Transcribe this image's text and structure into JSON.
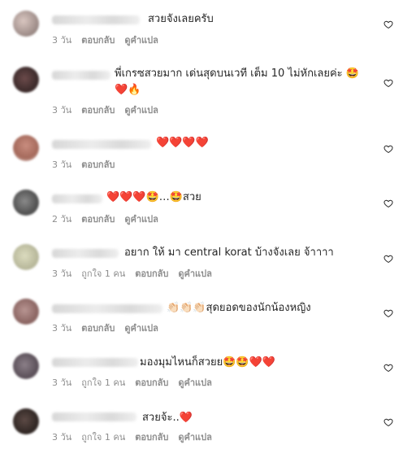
{
  "comments": [
    {
      "text": "สวยจังเลยครับ",
      "time": "3 วัน",
      "reply": "ตอบกลับ",
      "translate": "ดูคำแปล"
    },
    {
      "text": "พี่เกรซสวยมาก เด่นสุดบนเวที เต็ม 10 ไม่หักเลยค่ะ 🤩\n❤️🔥",
      "time": "3 วัน",
      "reply": "ตอบกลับ",
      "translate": "ดูคำแปล"
    },
    {
      "text": "❤️❤️❤️❤️",
      "time": "3 วัน",
      "reply": "ตอบกลับ"
    },
    {
      "text": "❤️❤️❤️🤩…🤩สวย",
      "time": "2 วัน",
      "reply": "ตอบกลับ",
      "translate": "ดูคำแปล"
    },
    {
      "text": "อยาก ให้ มา central korat บ้างจังเลย จ้าาาา",
      "time": "3 วัน",
      "likes": "ถูกใจ 1 คน",
      "reply": "ตอบกลับ",
      "translate": "ดูคำแปล"
    },
    {
      "text": "👏🏻👏🏻👏🏻สุดยอดของนักน้องหญิง",
      "time": "3 วัน",
      "reply": "ตอบกลับ",
      "translate": "ดูคำแปล"
    },
    {
      "text": "มองมุมไหนก็สวยย🤩🤩❤️❤️",
      "time": "3 วัน",
      "likes": "ถูกใจ 1 คน",
      "reply": "ตอบกลับ",
      "translate": "ดูคำแปล"
    },
    {
      "text": "สวยจ้ะ..❤️",
      "time": "3 วัน",
      "likes": "ถูกใจ 1 คน",
      "reply": "ตอบกลับ",
      "translate": "ดูคำแปล"
    }
  ],
  "icons": {
    "like": "heart-outline-icon"
  },
  "colors": {
    "text": "#262626",
    "meta": "#8e8e8e"
  }
}
